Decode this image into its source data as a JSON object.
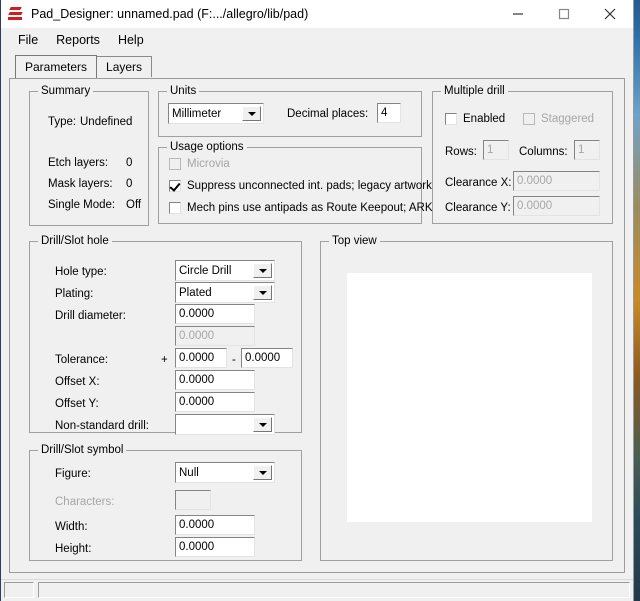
{
  "window": {
    "title": "Pad_Designer: unnamed.pad (F:.../allegro/lib/pad)",
    "icon": "allegro-pad-icon",
    "minimize_label": "—",
    "maximize_label": "□",
    "close_label": "✕"
  },
  "menubar": {
    "items": [
      {
        "label": "File"
      },
      {
        "label": "Reports"
      },
      {
        "label": "Help"
      }
    ]
  },
  "tabs": [
    {
      "label": "Parameters",
      "active": true
    },
    {
      "label": "Layers",
      "active": false
    }
  ],
  "summary": {
    "title": "Summary",
    "rows": [
      {
        "label": "Type:",
        "value": "Undefined"
      },
      {
        "label": "Etch layers:",
        "value": "0"
      },
      {
        "label": "Mask layers:",
        "value": "0"
      },
      {
        "label": "Single Mode:",
        "value": "Off"
      }
    ]
  },
  "units": {
    "title": "Units",
    "unit_value": "Millimeter",
    "decimal_places_label": "Decimal places:",
    "decimal_places_value": "4"
  },
  "usage_options": {
    "title": "Usage options",
    "options": [
      {
        "label": "Microvia",
        "checked": false,
        "disabled": true
      },
      {
        "label": "Suppress unconnected int. pads; legacy artwork",
        "checked": true,
        "disabled": false
      },
      {
        "label": "Mech pins use antipads as Route Keepout; ARK",
        "checked": false,
        "disabled": false
      }
    ]
  },
  "multiple_drill": {
    "title": "Multiple drill",
    "enabled_label": "Enabled",
    "enabled_checked": false,
    "staggered_label": "Staggered",
    "staggered_checked": false,
    "rows_label": "Rows:",
    "rows_value": "1",
    "columns_label": "Columns:",
    "columns_value": "1",
    "clearance_x_label": "Clearance X:",
    "clearance_x_value": "0.0000",
    "clearance_y_label": "Clearance Y:",
    "clearance_y_value": "0.0000"
  },
  "drill_slot_hole": {
    "title": "Drill/Slot hole",
    "hole_type_label": "Hole type:",
    "hole_type_value": "Circle Drill",
    "plating_label": "Plating:",
    "plating_value": "Plated",
    "drill_diameter_label": "Drill diameter:",
    "drill_diameter_value": "0.0000",
    "drill_diameter_2_value": "0.0000",
    "tolerance_label": "Tolerance:",
    "tolerance_plus_sign": "+",
    "tolerance_plus_value": "0.0000",
    "tolerance_minus_sign": "-",
    "tolerance_minus_value": "0.0000",
    "offset_x_label": "Offset X:",
    "offset_x_value": "0.0000",
    "offset_y_label": "Offset Y:",
    "offset_y_value": "0.0000",
    "non_standard_drill_label": "Non-standard drill:",
    "non_standard_drill_value": ""
  },
  "drill_slot_symbol": {
    "title": "Drill/Slot symbol",
    "figure_label": "Figure:",
    "figure_value": "Null",
    "characters_label": "Characters:",
    "characters_value": "",
    "width_label": "Width:",
    "width_value": "0.0000",
    "height_label": "Height:",
    "height_value": "0.0000"
  },
  "top_view": {
    "title": "Top view",
    "canvas_color": "#ffffff"
  },
  "statusbar": {
    "pane1": "",
    "pane2": ""
  }
}
